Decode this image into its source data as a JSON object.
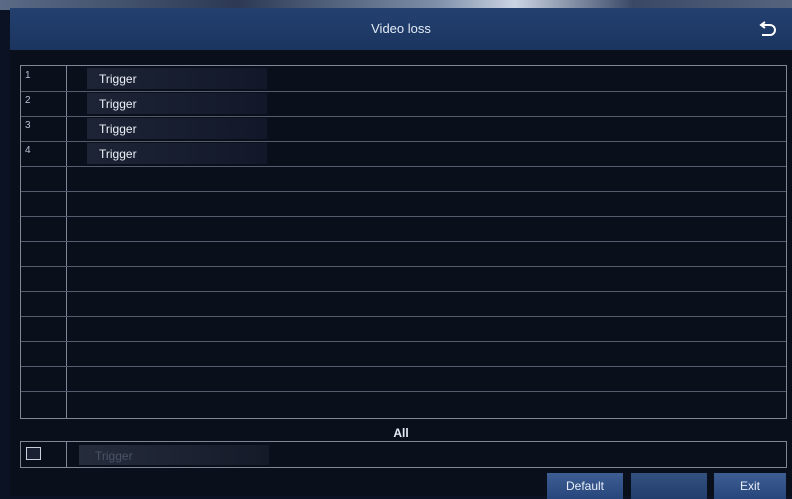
{
  "window": {
    "title": "Video loss"
  },
  "channels": [
    {
      "number": "1",
      "action": "Trigger"
    },
    {
      "number": "2",
      "action": "Trigger"
    },
    {
      "number": "3",
      "action": "Trigger"
    },
    {
      "number": "4",
      "action": "Trigger"
    }
  ],
  "all": {
    "label": "All",
    "action": "Trigger"
  },
  "buttons": {
    "default": "Default",
    "apply": "",
    "exit": "Exit"
  },
  "icons": {
    "return": "return-arrow-icon",
    "checkbox": "checkbox-icon"
  },
  "colors": {
    "titlebar": "#1f3a66",
    "background": "#0a0f1c",
    "button": "#2f4f86"
  }
}
